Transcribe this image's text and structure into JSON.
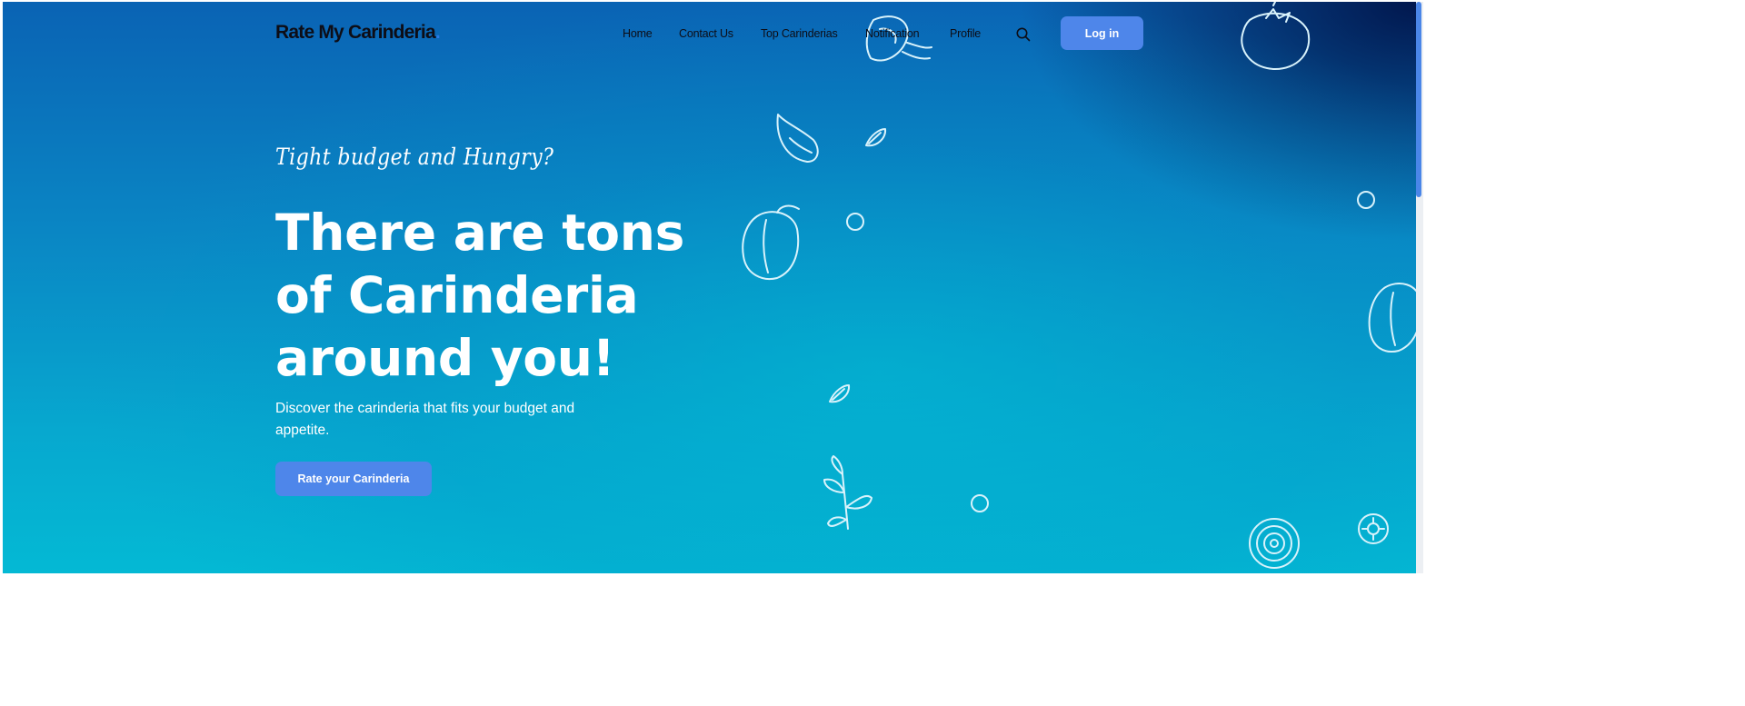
{
  "brand": {
    "name": "Rate My Carinderia",
    "dot": "."
  },
  "nav": {
    "items": [
      {
        "label": "Home"
      },
      {
        "label": "Contact Us"
      },
      {
        "label": "Top Carinderias"
      },
      {
        "label": "Notification"
      },
      {
        "label": "Profile"
      }
    ],
    "search_icon": "search-icon",
    "login_label": "Log in"
  },
  "hero": {
    "tagline": "Tight budget and Hungry?",
    "headline_line1": "There are tons",
    "headline_line2": "of Carinderia",
    "headline_line3": "around you!",
    "subtext_line1": "Discover the carinderia that fits your budget and",
    "subtext_line2": "appetite.",
    "cta_label": "Rate your Carinderia"
  },
  "decorations": [
    "shrimp-icon",
    "tomato-icon",
    "garlic-clove-icon",
    "seed-icon",
    "bell-pepper-icon",
    "ring-icon",
    "parsley-icon",
    "onion-slice-icon",
    "lemon-slice-icon"
  ],
  "colors": {
    "accent": "#4e86ea",
    "text_dark": "#0d0d16",
    "hero_top": "#0a63b4",
    "hero_bottom": "#04b9d4",
    "scrollbar": "#4a86e8"
  }
}
